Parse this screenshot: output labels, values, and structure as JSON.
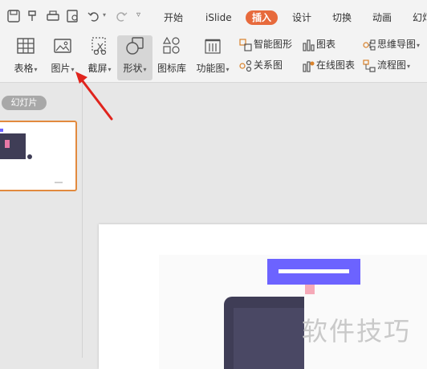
{
  "tabs": [
    "开始",
    "iSlide",
    "插入",
    "设计",
    "切换",
    "动画",
    "幻灯"
  ],
  "ribbon": {
    "table": "表格",
    "picture": "图片",
    "screenshot": "截屏",
    "shape": "形状",
    "icon_lib": "图标库",
    "func_chart": "功能图",
    "smart_shape": "智能图形",
    "chart": "图表",
    "mind_map": "思维导图",
    "relation_chart": "关系图",
    "online_chart": "在线图表",
    "flowchart": "流程图"
  },
  "panel": {
    "slides_label": "幻灯片"
  },
  "watermark": "软件技巧",
  "colors": {
    "accent": "#e76a3c",
    "arrow": "#e0241d",
    "slide_bar": "#6c63ff",
    "dark_block": "#3f3d56"
  }
}
